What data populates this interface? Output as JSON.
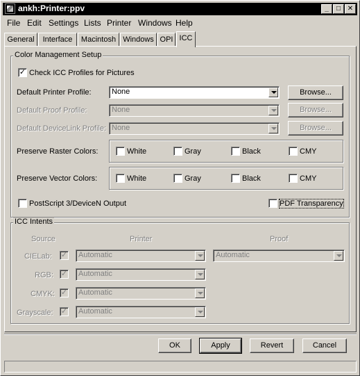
{
  "window": {
    "title": "ankh:Printer:ppv"
  },
  "titlebar_buttons": {
    "minimize": "_",
    "maximize": "□",
    "close": "✕"
  },
  "menu": [
    "File",
    "Edit",
    "Settings",
    "Lists",
    "Printer",
    "Windows",
    "Help"
  ],
  "tabs": [
    "General",
    "Interface",
    "Macintosh",
    "Windows",
    "OPI",
    "ICC"
  ],
  "active_tab": "ICC",
  "color_management": {
    "legend": "Color Management Setup",
    "check_icc": {
      "label": "Check ICC Profiles for Pictures",
      "checked": "✓"
    },
    "default_printer": {
      "label": "Default Printer Profile:",
      "value": "None",
      "browse": "Browse..."
    },
    "default_proof": {
      "label": "Default Proof Profile:",
      "value": "None",
      "browse": "Browse..."
    },
    "default_devicelink": {
      "label": "Default DeviceLink Profile:",
      "value": "None",
      "browse": "Browse..."
    },
    "preserve_raster": {
      "label": "Preserve Raster Colors:",
      "options": [
        "White",
        "Gray",
        "Black",
        "CMY"
      ]
    },
    "preserve_vector": {
      "label": "Preserve Vector Colors:",
      "options": [
        "White",
        "Gray",
        "Black",
        "CMY"
      ]
    },
    "postscript3": {
      "label": "PostScript 3/DeviceN Output"
    },
    "pdf_transparency": {
      "label": "PDF Transparency"
    }
  },
  "icc_intents": {
    "legend": "ICC Intents",
    "headers": {
      "source": "Source",
      "printer": "Printer",
      "proof": "Proof"
    },
    "rows": [
      {
        "source": "CIELab:",
        "checked": "✓",
        "printer": "Automatic",
        "proof": "Automatic"
      },
      {
        "source": "RGB:",
        "checked": "✓",
        "printer": "Automatic"
      },
      {
        "source": "CMYK:",
        "checked": "✓",
        "printer": "Automatic"
      },
      {
        "source": "Grayscale:",
        "checked": "✓",
        "printer": "Automatic"
      }
    ]
  },
  "buttons": {
    "ok": "OK",
    "apply": "Apply",
    "revert": "Revert",
    "cancel": "Cancel"
  }
}
